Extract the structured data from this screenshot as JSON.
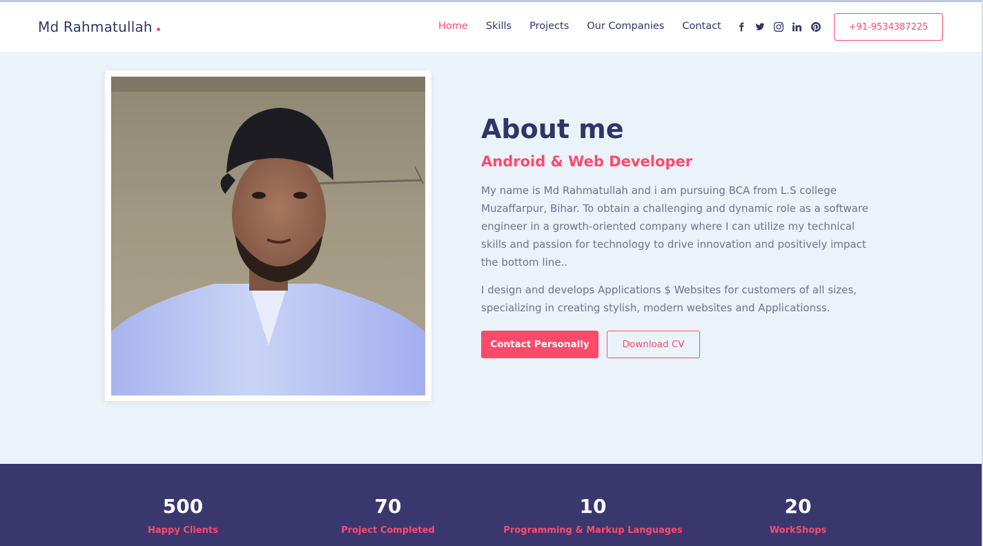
{
  "header": {
    "brand": "Md Rahmatullah",
    "nav": [
      {
        "label": "Home",
        "active": true
      },
      {
        "label": "Skills"
      },
      {
        "label": "Projects"
      },
      {
        "label": "Our Companies"
      },
      {
        "label": "Contact"
      }
    ],
    "socials": [
      "facebook-icon",
      "twitter-icon",
      "instagram-icon",
      "linkedin-icon",
      "pinterest-icon"
    ],
    "phone": "+91-9534387225"
  },
  "about": {
    "title": "About me",
    "subtitle": "Android & Web Developer",
    "paragraph1": "My name is Md Rahmatullah and i am pursuing BCA from L.S college Muzaffarpur, Bihar. To obtain a challenging and dynamic role as a software engineer in a growth-oriented company where I can utilize my technical skills and passion for technology to drive innovation and positively impact the bottom line..",
    "paragraph2": "I design and develops Applications $ Websites for customers of all sizes, specializing in creating stylish, modern websites and Applicationss.",
    "primary_button": "Contact Personally",
    "secondary_button": "Download CV"
  },
  "stats": [
    {
      "value": "500",
      "label": "Happy Clients"
    },
    {
      "value": "70",
      "label": "Project Completed"
    },
    {
      "value": "10",
      "label": "Programming & Markup Languages"
    },
    {
      "value": "20",
      "label": "WorkShops"
    }
  ],
  "colors": {
    "accent": "#ff4a6b",
    "navy": "#2f3566",
    "stats_bg": "#3a376f",
    "page_bg": "#eaf2fa"
  }
}
